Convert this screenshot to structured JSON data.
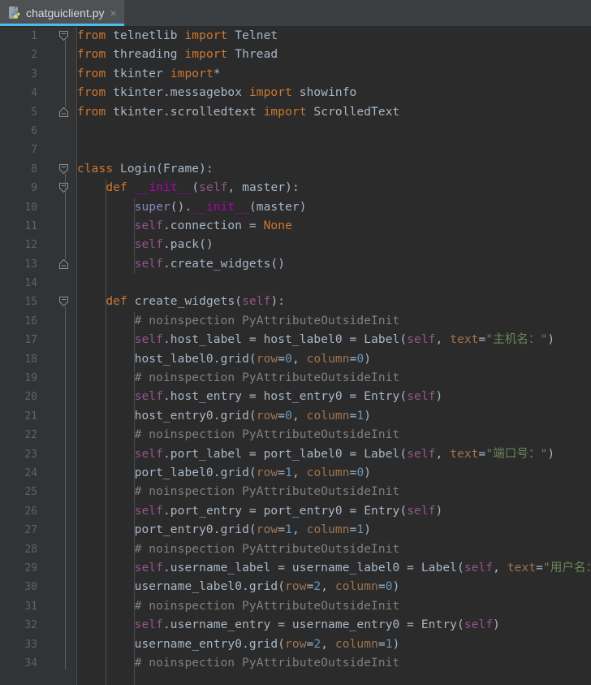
{
  "window": {
    "background_color": "#2b2b2b",
    "gutter_color": "#313335"
  },
  "tabbar": {
    "background_color": "#3c3f41",
    "active_underline_color": "#4dbce9",
    "tabs": [
      {
        "label": "chatguiclient.py",
        "icon": "python-file-icon",
        "close_label": "×",
        "active": true
      }
    ]
  },
  "editor": {
    "language": "Python",
    "font_size_px": 14.5,
    "line_height_px": 23.4,
    "first_visible_line": 1,
    "last_visible_line": 34,
    "theme": "Darcula",
    "colors": {
      "keyword": "#cc7832",
      "comment": "#808080",
      "string": "#6a8759",
      "number": "#6897bb",
      "self": "#94558d",
      "function_def": "#b200b2",
      "builtin": "#8888c6",
      "keyword_argument": "#a1744e",
      "plain_text": "#a9b7c6",
      "line_number": "#606366"
    },
    "lines": [
      {
        "n": 1,
        "fold": "collapse-start",
        "indent": 0,
        "tokens": [
          [
            "kw",
            "from"
          ],
          [
            "pln",
            " telnetlib "
          ],
          [
            "kw",
            "import"
          ],
          [
            "pln",
            " Telnet"
          ]
        ]
      },
      {
        "n": 2,
        "fold": "none",
        "indent": 0,
        "tokens": [
          [
            "kw",
            "from"
          ],
          [
            "pln",
            " threading "
          ],
          [
            "kw",
            "import"
          ],
          [
            "pln",
            " Thread"
          ]
        ]
      },
      {
        "n": 3,
        "fold": "none",
        "indent": 0,
        "tokens": [
          [
            "kw",
            "from"
          ],
          [
            "pln",
            " tkinter "
          ],
          [
            "kw",
            "import"
          ],
          [
            "pln",
            "*"
          ]
        ]
      },
      {
        "n": 4,
        "fold": "none",
        "indent": 0,
        "tokens": [
          [
            "kw",
            "from"
          ],
          [
            "pln",
            " tkinter.messagebox "
          ],
          [
            "kw",
            "import"
          ],
          [
            "pln",
            " showinfo"
          ]
        ]
      },
      {
        "n": 5,
        "fold": "collapse-end",
        "indent": 0,
        "tokens": [
          [
            "kw",
            "from"
          ],
          [
            "pln",
            " tkinter.scrolledtext "
          ],
          [
            "kw",
            "import"
          ],
          [
            "pln",
            " ScrolledText"
          ]
        ]
      },
      {
        "n": 6,
        "fold": "none",
        "indent": 0,
        "tokens": []
      },
      {
        "n": 7,
        "fold": "none",
        "indent": 0,
        "tokens": []
      },
      {
        "n": 8,
        "fold": "collapse-start",
        "indent": 0,
        "tokens": [
          [
            "kw",
            "class"
          ],
          [
            "pln",
            " Login(Frame):"
          ]
        ]
      },
      {
        "n": 9,
        "fold": "collapse-start",
        "indent": 1,
        "tokens": [
          [
            "pln",
            "    "
          ],
          [
            "kw",
            "def"
          ],
          [
            "pln",
            " "
          ],
          [
            "fn",
            "__init__"
          ],
          [
            "pln",
            "("
          ],
          [
            "sf",
            "self"
          ],
          [
            "pln",
            ", master):"
          ]
        ]
      },
      {
        "n": 10,
        "fold": "none",
        "indent": 2,
        "tokens": [
          [
            "pln",
            "        "
          ],
          [
            "bi",
            "super"
          ],
          [
            "pln",
            "()."
          ],
          [
            "fn",
            "__init__"
          ],
          [
            "pln",
            "(master)"
          ]
        ]
      },
      {
        "n": 11,
        "fold": "none",
        "indent": 2,
        "tokens": [
          [
            "pln",
            "        "
          ],
          [
            "sf",
            "self"
          ],
          [
            "pln",
            ".connection = "
          ],
          [
            "kw",
            "None"
          ]
        ]
      },
      {
        "n": 12,
        "fold": "none",
        "indent": 2,
        "tokens": [
          [
            "pln",
            "        "
          ],
          [
            "sf",
            "self"
          ],
          [
            "pln",
            ".pack()"
          ]
        ]
      },
      {
        "n": 13,
        "fold": "collapse-end",
        "indent": 2,
        "tokens": [
          [
            "pln",
            "        "
          ],
          [
            "sf",
            "self"
          ],
          [
            "pln",
            ".create_widgets()"
          ]
        ]
      },
      {
        "n": 14,
        "fold": "none",
        "indent": 0,
        "tokens": []
      },
      {
        "n": 15,
        "fold": "collapse-start",
        "indent": 1,
        "tokens": [
          [
            "pln",
            "    "
          ],
          [
            "kw",
            "def"
          ],
          [
            "pln",
            " create_widgets("
          ],
          [
            "sf",
            "self"
          ],
          [
            "pln",
            "):"
          ]
        ]
      },
      {
        "n": 16,
        "fold": "none",
        "indent": 2,
        "tokens": [
          [
            "pln",
            "        "
          ],
          [
            "cmt",
            "# noinspection PyAttributeOutsideInit"
          ]
        ]
      },
      {
        "n": 17,
        "fold": "none",
        "indent": 2,
        "tokens": [
          [
            "pln",
            "        "
          ],
          [
            "sf",
            "self"
          ],
          [
            "pln",
            ".host_label = host_label0 = Label("
          ],
          [
            "sf",
            "self"
          ],
          [
            "pln",
            ", "
          ],
          [
            "kwarg",
            "text"
          ],
          [
            "pln",
            "="
          ],
          [
            "str",
            "\"主机名：\""
          ],
          [
            "pln",
            ")"
          ]
        ]
      },
      {
        "n": 18,
        "fold": "none",
        "indent": 2,
        "tokens": [
          [
            "pln",
            "        host_label0.grid("
          ],
          [
            "kwarg",
            "row"
          ],
          [
            "pln",
            "="
          ],
          [
            "num",
            "0"
          ],
          [
            "pln",
            ", "
          ],
          [
            "kwarg",
            "column"
          ],
          [
            "pln",
            "="
          ],
          [
            "num",
            "0"
          ],
          [
            "pln",
            ")"
          ]
        ]
      },
      {
        "n": 19,
        "fold": "none",
        "indent": 2,
        "tokens": [
          [
            "pln",
            "        "
          ],
          [
            "cmt",
            "# noinspection PyAttributeOutsideInit"
          ]
        ]
      },
      {
        "n": 20,
        "fold": "none",
        "indent": 2,
        "tokens": [
          [
            "pln",
            "        "
          ],
          [
            "sf",
            "self"
          ],
          [
            "pln",
            ".host_entry = host_entry0 = Entry("
          ],
          [
            "sf",
            "self"
          ],
          [
            "pln",
            ")"
          ]
        ]
      },
      {
        "n": 21,
        "fold": "none",
        "indent": 2,
        "tokens": [
          [
            "pln",
            "        host_entry0.grid("
          ],
          [
            "kwarg",
            "row"
          ],
          [
            "pln",
            "="
          ],
          [
            "num",
            "0"
          ],
          [
            "pln",
            ", "
          ],
          [
            "kwarg",
            "column"
          ],
          [
            "pln",
            "="
          ],
          [
            "num",
            "1"
          ],
          [
            "pln",
            ")"
          ]
        ]
      },
      {
        "n": 22,
        "fold": "none",
        "indent": 2,
        "tokens": [
          [
            "pln",
            "        "
          ],
          [
            "cmt",
            "# noinspection PyAttributeOutsideInit"
          ]
        ]
      },
      {
        "n": 23,
        "fold": "none",
        "indent": 2,
        "tokens": [
          [
            "pln",
            "        "
          ],
          [
            "sf",
            "self"
          ],
          [
            "pln",
            ".port_label = port_label0 = Label("
          ],
          [
            "sf",
            "self"
          ],
          [
            "pln",
            ", "
          ],
          [
            "kwarg",
            "text"
          ],
          [
            "pln",
            "="
          ],
          [
            "str",
            "\"端口号：\""
          ],
          [
            "pln",
            ")"
          ]
        ]
      },
      {
        "n": 24,
        "fold": "none",
        "indent": 2,
        "tokens": [
          [
            "pln",
            "        port_label0.grid("
          ],
          [
            "kwarg",
            "row"
          ],
          [
            "pln",
            "="
          ],
          [
            "num",
            "1"
          ],
          [
            "pln",
            ", "
          ],
          [
            "kwarg",
            "column"
          ],
          [
            "pln",
            "="
          ],
          [
            "num",
            "0"
          ],
          [
            "pln",
            ")"
          ]
        ]
      },
      {
        "n": 25,
        "fold": "none",
        "indent": 2,
        "tokens": [
          [
            "pln",
            "        "
          ],
          [
            "cmt",
            "# noinspection PyAttributeOutsideInit"
          ]
        ]
      },
      {
        "n": 26,
        "fold": "none",
        "indent": 2,
        "tokens": [
          [
            "pln",
            "        "
          ],
          [
            "sf",
            "self"
          ],
          [
            "pln",
            ".port_entry = port_entry0 = Entry("
          ],
          [
            "sf",
            "self"
          ],
          [
            "pln",
            ")"
          ]
        ]
      },
      {
        "n": 27,
        "fold": "none",
        "indent": 2,
        "tokens": [
          [
            "pln",
            "        port_entry0.grid("
          ],
          [
            "kwarg",
            "row"
          ],
          [
            "pln",
            "="
          ],
          [
            "num",
            "1"
          ],
          [
            "pln",
            ", "
          ],
          [
            "kwarg",
            "column"
          ],
          [
            "pln",
            "="
          ],
          [
            "num",
            "1"
          ],
          [
            "pln",
            ")"
          ]
        ]
      },
      {
        "n": 28,
        "fold": "none",
        "indent": 2,
        "tokens": [
          [
            "pln",
            "        "
          ],
          [
            "cmt",
            "# noinspection PyAttributeOutsideInit"
          ]
        ]
      },
      {
        "n": 29,
        "fold": "none",
        "indent": 2,
        "tokens": [
          [
            "pln",
            "        "
          ],
          [
            "sf",
            "self"
          ],
          [
            "pln",
            ".username_label = username_label0 = Label("
          ],
          [
            "sf",
            "self"
          ],
          [
            "pln",
            ", "
          ],
          [
            "kwarg",
            "text"
          ],
          [
            "pln",
            "="
          ],
          [
            "str",
            "\"用户名：\""
          ],
          [
            "pln",
            ")"
          ]
        ]
      },
      {
        "n": 30,
        "fold": "none",
        "indent": 2,
        "tokens": [
          [
            "pln",
            "        username_label0.grid("
          ],
          [
            "kwarg",
            "row"
          ],
          [
            "pln",
            "="
          ],
          [
            "num",
            "2"
          ],
          [
            "pln",
            ", "
          ],
          [
            "kwarg",
            "column"
          ],
          [
            "pln",
            "="
          ],
          [
            "num",
            "0"
          ],
          [
            "pln",
            ")"
          ]
        ]
      },
      {
        "n": 31,
        "fold": "none",
        "indent": 2,
        "tokens": [
          [
            "pln",
            "        "
          ],
          [
            "cmt",
            "# noinspection PyAttributeOutsideInit"
          ]
        ]
      },
      {
        "n": 32,
        "fold": "none",
        "indent": 2,
        "tokens": [
          [
            "pln",
            "        "
          ],
          [
            "sf",
            "self"
          ],
          [
            "pln",
            ".username_entry = username_entry0 = Entry("
          ],
          [
            "sf",
            "self"
          ],
          [
            "pln",
            ")"
          ]
        ]
      },
      {
        "n": 33,
        "fold": "none",
        "indent": 2,
        "tokens": [
          [
            "pln",
            "        username_entry0.grid("
          ],
          [
            "kwarg",
            "row"
          ],
          [
            "pln",
            "="
          ],
          [
            "num",
            "2"
          ],
          [
            "pln",
            ", "
          ],
          [
            "kwarg",
            "column"
          ],
          [
            "pln",
            "="
          ],
          [
            "num",
            "1"
          ],
          [
            "pln",
            ")"
          ]
        ]
      },
      {
        "n": 34,
        "fold": "none",
        "indent": 2,
        "tokens": [
          [
            "pln",
            "        "
          ],
          [
            "cmt",
            "# noinspection PyAttributeOutsideInit"
          ]
        ]
      }
    ]
  }
}
